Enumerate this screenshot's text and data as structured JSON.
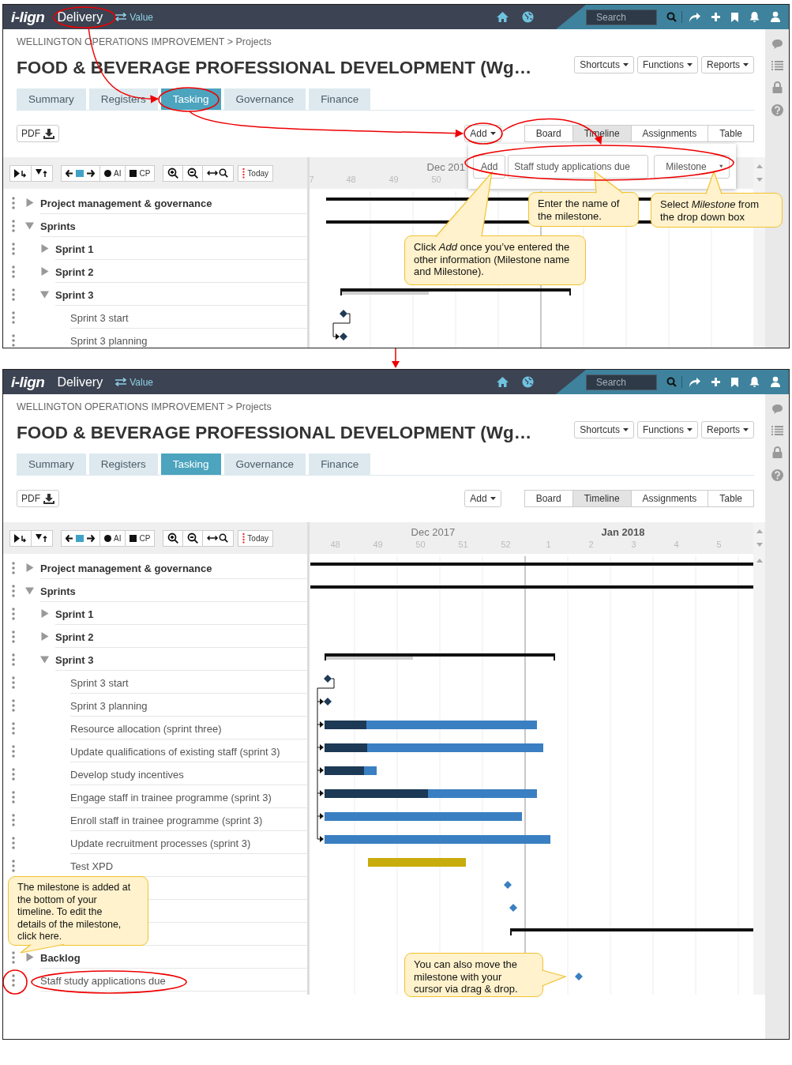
{
  "screens": [
    {
      "topbar": {
        "logo": "i-lign",
        "module": "Delivery",
        "switch_label": "Value",
        "search": {
          "placeholder": "Search"
        }
      },
      "breadcrumb": "WELLINGTON OPERATIONS IMPROVEMENT > Projects",
      "title": "FOOD & BEVERAGE PROFESSIONAL DEVELOPMENT (Wg…",
      "menus": [
        "Shortcuts",
        "Functions",
        "Reports"
      ],
      "tabs": [
        {
          "label": "Summary",
          "selected": false
        },
        {
          "label": "Registers",
          "selected": false
        },
        {
          "label": "Tasking",
          "selected": true
        },
        {
          "label": "Governance",
          "selected": false
        },
        {
          "label": "Finance",
          "selected": false
        }
      ],
      "pdf_button": "PDF",
      "add_button": "Add",
      "views": [
        {
          "label": "Board",
          "selected": false
        },
        {
          "label": "Timeline",
          "selected": true
        },
        {
          "label": "Assignments",
          "selected": false
        },
        {
          "label": "Table",
          "selected": false
        }
      ],
      "toolbar": {
        "ai": "AI",
        "cp": "CP",
        "today": "Today"
      },
      "timeline_header": {
        "months": [
          "Dec 201"
        ],
        "weeks": [
          "7",
          "48",
          "49",
          "50"
        ]
      },
      "tasks": [
        {
          "label": "Project management & governance",
          "kind": "group",
          "expanded": false
        },
        {
          "label": "Sprints",
          "kind": "group",
          "expanded": true,
          "children": [
            {
              "label": "Sprint 1",
              "kind": "group",
              "expanded": false
            },
            {
              "label": "Sprint 2",
              "kind": "group",
              "expanded": false
            },
            {
              "label": "Sprint 3",
              "kind": "group",
              "expanded": true,
              "children": [
                {
                  "label": "Sprint 3 start",
                  "kind": "task"
                },
                {
                  "label": "Sprint 3 planning",
                  "kind": "task"
                }
              ]
            }
          ]
        }
      ],
      "add_popup": {
        "button": "Add",
        "name_value": "Staff study applications due",
        "type_value": "Milestone"
      },
      "callouts": [
        "Enter the name of the milestone.",
        "Select *Milestone* from the drop down box",
        "Click *Add* once you’ve entered the other information (Milestone name and Milestone)."
      ]
    },
    {
      "topbar": {
        "logo": "i-lign",
        "module": "Delivery",
        "switch_label": "Value",
        "search": {
          "placeholder": "Search"
        }
      },
      "breadcrumb": "WELLINGTON OPERATIONS IMPROVEMENT > Projects",
      "title": "FOOD & BEVERAGE PROFESSIONAL DEVELOPMENT (Wg…",
      "menus": [
        "Shortcuts",
        "Functions",
        "Reports"
      ],
      "tabs": [
        {
          "label": "Summary",
          "selected": false
        },
        {
          "label": "Registers",
          "selected": false
        },
        {
          "label": "Tasking",
          "selected": true
        },
        {
          "label": "Governance",
          "selected": false
        },
        {
          "label": "Finance",
          "selected": false
        }
      ],
      "pdf_button": "PDF",
      "add_button": "Add",
      "views": [
        {
          "label": "Board",
          "selected": false
        },
        {
          "label": "Timeline",
          "selected": true
        },
        {
          "label": "Assignments",
          "selected": false
        },
        {
          "label": "Table",
          "selected": false
        }
      ],
      "toolbar": {
        "ai": "AI",
        "cp": "CP",
        "today": "Today"
      },
      "timeline_header": {
        "months": [
          "Dec 2017",
          "Jan 2018"
        ],
        "weeks": [
          "48",
          "49",
          "50",
          "51",
          "52",
          "1",
          "2",
          "3",
          "4",
          "5"
        ]
      },
      "tasks": [
        {
          "label": "Project management & governance",
          "kind": "group",
          "expanded": false
        },
        {
          "label": "Sprints",
          "kind": "group",
          "expanded": true,
          "children": [
            {
              "label": "Sprint 1",
              "kind": "group",
              "expanded": false
            },
            {
              "label": "Sprint 2",
              "kind": "group",
              "expanded": false
            },
            {
              "label": "Sprint 3",
              "kind": "group",
              "expanded": true,
              "children": [
                {
                  "label": "Sprint 3 start",
                  "kind": "task"
                },
                {
                  "label": "Sprint 3 planning",
                  "kind": "task"
                },
                {
                  "label": "Resource allocation (sprint three)",
                  "kind": "task"
                },
                {
                  "label": "Update qualifications of existing staff (sprint 3)",
                  "kind": "task"
                },
                {
                  "label": "Develop study incentives",
                  "kind": "task"
                },
                {
                  "label": "Engage staff in trainee programme (sprint 3)",
                  "kind": "task"
                },
                {
                  "label": "Enroll staff in trainee programme (sprint 3)",
                  "kind": "task"
                },
                {
                  "label": "Update recruitment processes (sprint 3)",
                  "kind": "task"
                },
                {
                  "label": "Test XPD",
                  "kind": "task"
                }
              ]
            }
          ]
        },
        {
          "kind": "blank"
        },
        {
          "kind": "blank"
        },
        {
          "kind": "blank"
        },
        {
          "label": "Backlog",
          "kind": "group",
          "expanded": false
        },
        {
          "label": "Staff study applications due",
          "kind": "task"
        }
      ],
      "callouts": [
        "The milestone is added at the bottom of your timeline. To edit the details of the milestone, click here.",
        "You can also move the milestone with your cursor via drag & drop."
      ]
    }
  ]
}
